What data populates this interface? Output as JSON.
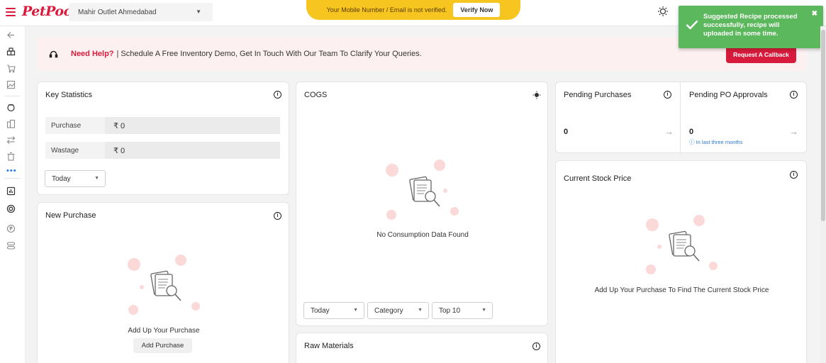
{
  "header": {
    "logo_text": "PetPooja",
    "outlet_name": "Mahir Outlet Ahmedabad",
    "verify_message": "Your Mobile Number / Email is not verified.",
    "verify_button": "Verify Now"
  },
  "toast": {
    "message": "Suggested Recipe processed successfully, recipe will uploaded in some time.",
    "close": "✖"
  },
  "help": {
    "title": "Need Help?",
    "message": "| Schedule A Free Inventory Demo, Get In Touch With Our Team To Clarify Your Queries.",
    "callback_button": "Request A Callback"
  },
  "key_statistics": {
    "title": "Key Statistics",
    "rows": [
      {
        "label": "Purchase",
        "value": "₹ 0"
      },
      {
        "label": "Wastage",
        "value": "₹ 0"
      }
    ],
    "period": "Today"
  },
  "new_purchase": {
    "title": "New Purchase",
    "empty_text": "Add Up Your Purchase",
    "button": "Add Purchase"
  },
  "cogs": {
    "title": "COGS",
    "empty_text": "No Consumption Data Found",
    "filters": {
      "period": "Today",
      "category": "Category",
      "top": "Top 10"
    }
  },
  "raw_materials": {
    "title": "Raw Materials"
  },
  "pending_purchases": {
    "title": "Pending Purchases",
    "count": "0"
  },
  "pending_po": {
    "title": "Pending PO Approvals",
    "count": "0",
    "note": "ⓘ In last three months"
  },
  "current_stock": {
    "title": "Current Stock Price",
    "empty_text": "Add Up Your Purchase To Find The Current Stock Price"
  },
  "colors": {
    "brand": "#d81b3c",
    "banner": "#f6c51f",
    "toast": "#5cb85c"
  }
}
